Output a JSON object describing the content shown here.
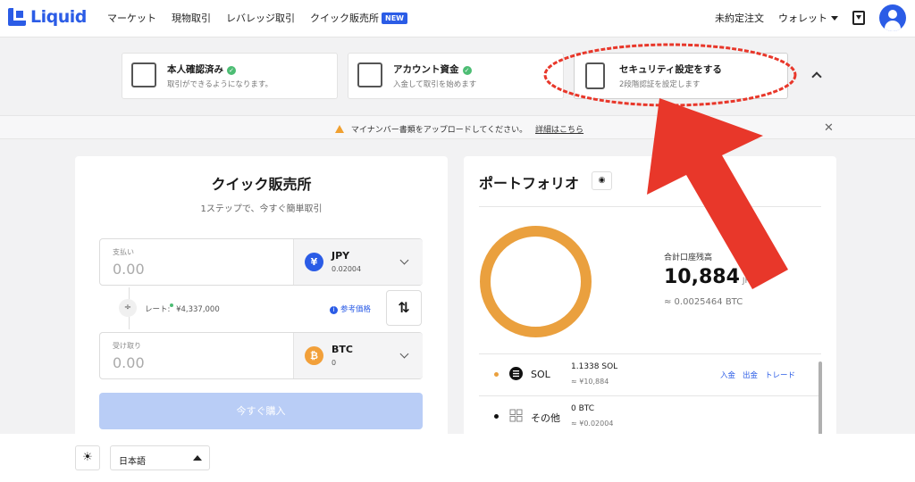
{
  "header": {
    "logo_text": "Liquid",
    "nav": [
      "マーケット",
      "現物取引",
      "レバレッジ取引",
      "クイック販売所"
    ],
    "new_badge": "NEW",
    "pending_orders": "未約定注文",
    "wallet": "ウォレット",
    "brand_color": "#2b5ce6"
  },
  "steps": [
    {
      "title": "本人確認済み",
      "sub": "取引ができるようになります。",
      "done": true
    },
    {
      "title": "アカウント資金",
      "sub": "入金して取引を始めます",
      "done": true
    },
    {
      "title": "セキュリティ設定をする",
      "sub": "2段階認証を設定します",
      "done": false
    }
  ],
  "notice": {
    "text": "マイナンバー書類をアップロードしてください。",
    "link": "詳細はこちら"
  },
  "quick": {
    "title": "クイック販売所",
    "subtitle": "1ステップで、今すぐ簡単取引",
    "pay": {
      "label": "支払い",
      "value": "0.00",
      "currency": "JPY",
      "balance": "0.02004",
      "symbol": "¥"
    },
    "rate_label": "レート:",
    "rate_value": "¥4,337,000",
    "reference": "参考価格",
    "receive": {
      "label": "受け取り",
      "value": "0.00",
      "currency": "BTC",
      "balance": "0",
      "symbol": "₿"
    },
    "buy_button": "今すぐ購入",
    "swap_icon": "⇅"
  },
  "portfolio": {
    "title": "ポートフォリオ",
    "balance_label": "合計口座残高",
    "balance": "10,884",
    "balance_unit": "JPY",
    "balance_btc": "≈ 0.0025464 BTC",
    "assets": [
      {
        "name": "SOL",
        "amount": "1.1338 SOL",
        "jpy": "≈ ¥10,884",
        "dot_color": "#eaa03e",
        "links": [
          "入金",
          "出金",
          "トレード"
        ]
      },
      {
        "name": "その他",
        "amount": "0 BTC",
        "jpy": "≈ ¥0.02004",
        "dot_color": "#111111",
        "links": []
      }
    ]
  },
  "footer": {
    "language": "日本語"
  },
  "annotation_color": "#e8372a"
}
